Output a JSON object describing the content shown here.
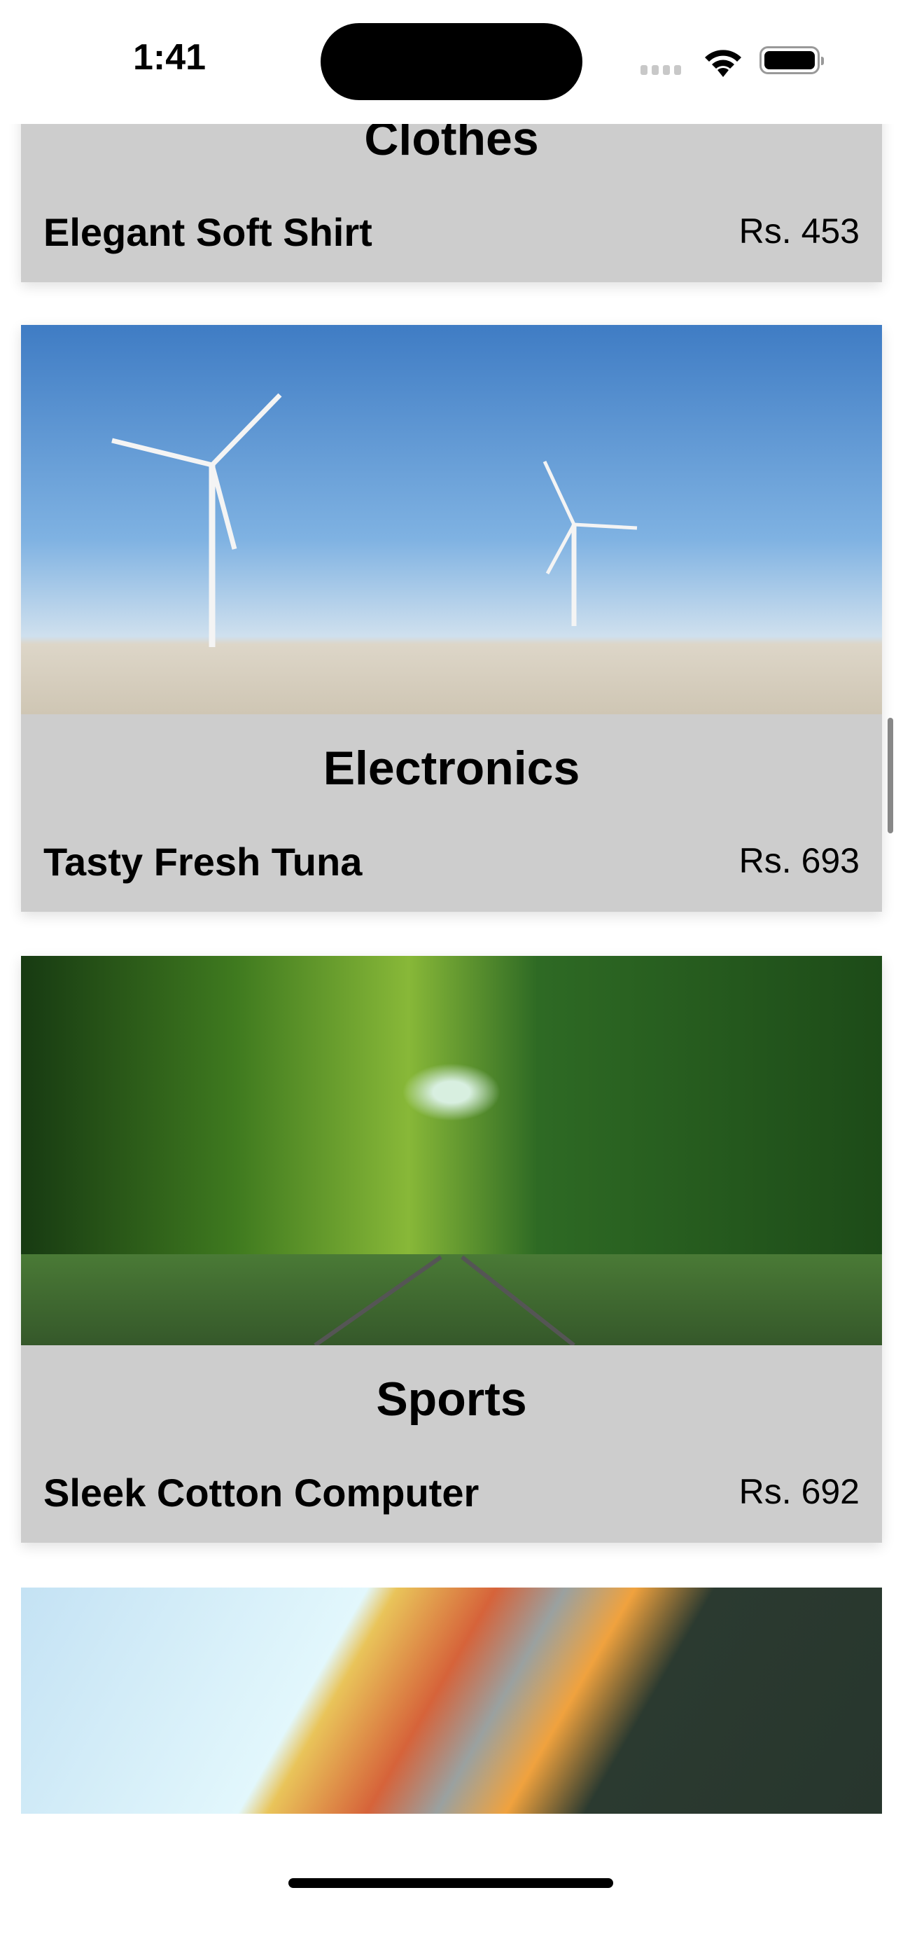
{
  "status_bar": {
    "time": "1:41"
  },
  "products": [
    {
      "category": "Clothes",
      "name": "Elegant Soft Shirt",
      "price": "Rs. 453",
      "image": "clothes-image"
    },
    {
      "category": "Electronics",
      "name": "Tasty Fresh Tuna",
      "price": "Rs. 693",
      "image": "wind-turbines-image"
    },
    {
      "category": "Sports",
      "name": "Sleek Cotton Computer",
      "price": "Rs. 692",
      "image": "railway-forest-image"
    },
    {
      "category": "",
      "name": "",
      "price": "",
      "image": "hot-air-balloon-image"
    }
  ]
}
